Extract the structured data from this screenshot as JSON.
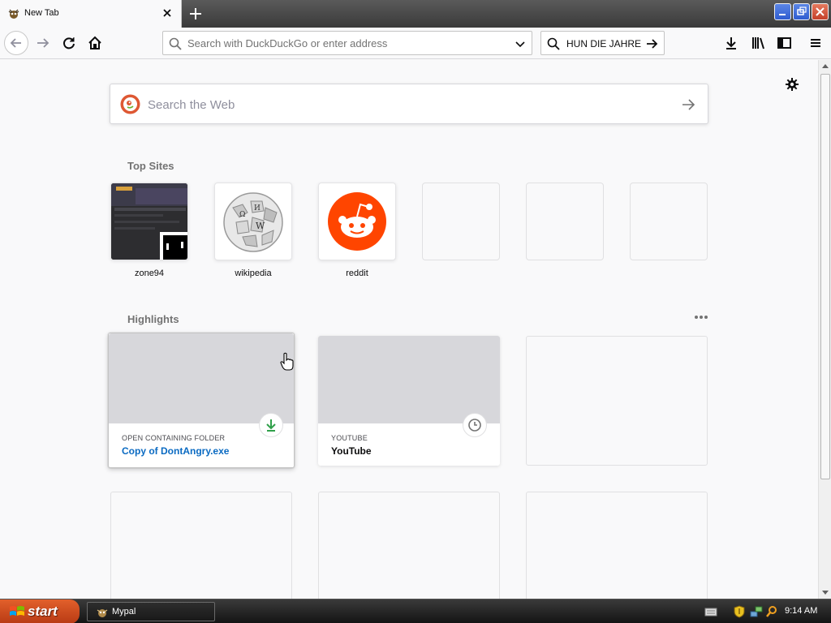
{
  "browser": {
    "tab_title": "New Tab",
    "url_placeholder": "Search with DuckDuckGo or enter address",
    "searchbar_text": "HUN DIE JAHRE"
  },
  "newtab": {
    "search_placeholder": "Search the Web",
    "topsites_title": "Top Sites",
    "topsites": [
      {
        "label": "zone94",
        "icon": "zone94-thumbnail"
      },
      {
        "label": "wikipedia",
        "icon": "wikipedia-globe-icon"
      },
      {
        "label": "reddit",
        "icon": "reddit-icon"
      },
      {
        "label": "",
        "icon": ""
      },
      {
        "label": "",
        "icon": ""
      },
      {
        "label": "",
        "icon": ""
      }
    ],
    "highlights_title": "Highlights",
    "highlights": [
      {
        "context": "OPEN CONTAINING FOLDER",
        "title": "Copy of DontAngry.exe",
        "badge": "download-icon"
      },
      {
        "context": "YOUTUBE",
        "title": "YouTube",
        "badge": "clock-icon"
      }
    ]
  },
  "taskbar": {
    "start_label": "start",
    "task_label": "Mypal",
    "clock": "9:14 AM"
  },
  "colors": {
    "reddit": "#ff4500",
    "download_badge": "#30a04a",
    "highlight_link": "#0a6ac2",
    "start_button": "#d04e1f"
  }
}
